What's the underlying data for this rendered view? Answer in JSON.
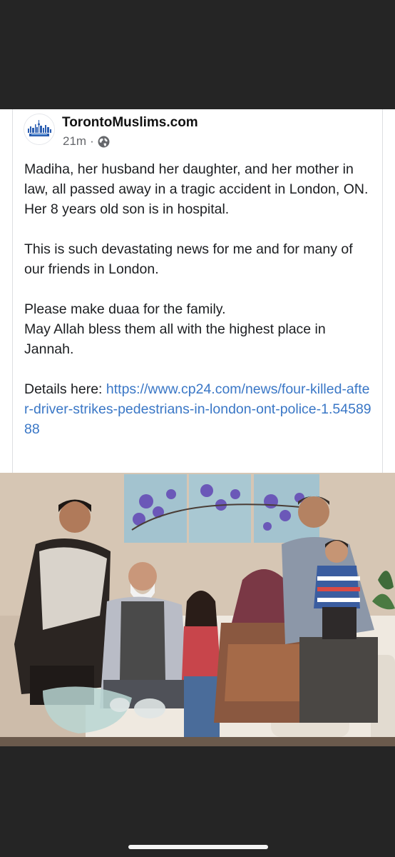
{
  "post": {
    "page_name": "TorontoMuslims.com",
    "timestamp": "21m",
    "separator": "·",
    "privacy_icon": "globe-icon",
    "avatar_logo_text": "Toronto Muslims",
    "paragraphs": [
      [
        "Madiha, her husband her daughter, and her mother in law, all passed away in a tragic accident in London, ON.",
        "Her 8 years old son is in hospital."
      ],
      [
        "This is such devastating news for me and for many of our friends in London."
      ],
      [
        "Please make duaa for the family.",
        "May Allah bless them all with the highest place in Jannah."
      ]
    ],
    "details_label": "Details here: ",
    "details_link": "https://www.cp24.com/news/four-killed-after-driver-strikes-pedestrians-in-london-ont-police-1.5458988",
    "link_color": "#3a77c6",
    "photo_description_icon": "family-photo"
  }
}
